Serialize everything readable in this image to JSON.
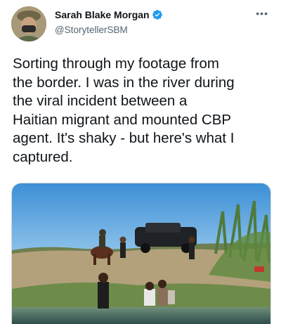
{
  "author": {
    "display_name": "Sarah Blake Morgan",
    "handle": "@StorytellerSBM",
    "verified": true
  },
  "tweet": {
    "text": "Sorting through my footage from\nthe border. I was in the river during\nthe viral incident between a\nHaitian migrant and mounted CBP\nagent. It's shaky - but here's what I\ncaptured."
  },
  "icons": {
    "verified": "verified-badge-icon",
    "more": "more-options-icon"
  },
  "colors": {
    "verified_blue": "#1d9bf0",
    "secondary_text": "#536471",
    "primary_text": "#0f1419"
  }
}
